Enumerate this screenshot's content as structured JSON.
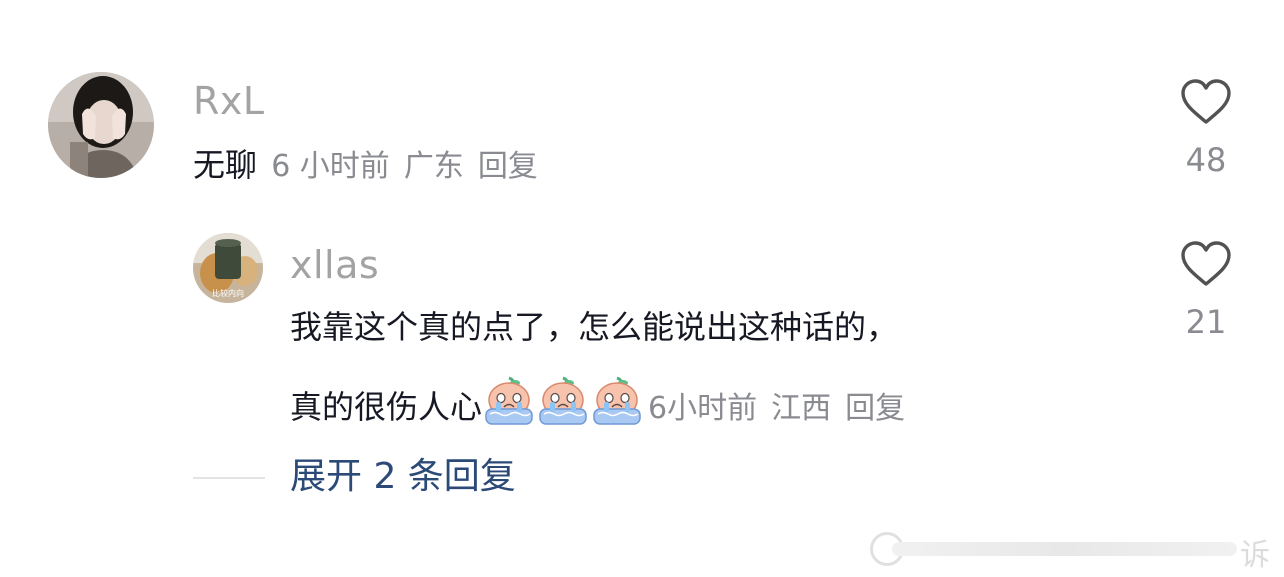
{
  "comments": [
    {
      "username": "RxL",
      "text": "无聊",
      "time": "6 小时前",
      "location": "广东",
      "reply_label": "回复",
      "likes": "48",
      "avatar_icon": "woman-covering-face-photo"
    }
  ],
  "reply": {
    "username": "xllas",
    "text_line1": "我靠这个真的点了，怎么能说出这种话的，",
    "text_line2": "真的很伤人心",
    "emoji_icon": "crying-peach-emoji",
    "emoji_count": 3,
    "time": "6小时前",
    "location": "江西",
    "reply_label": "回复",
    "likes": "21",
    "avatar_text": "比较内向",
    "avatar_icon": "dog-with-green-cup-photo"
  },
  "expand_label": "展开 2 条回复",
  "watermark_text": "诉",
  "colors": {
    "username": "#a3a3a3",
    "text": "#161823",
    "meta": "#8a8b91",
    "expand_link": "#2b4a78",
    "heart_stroke": "#525252"
  }
}
